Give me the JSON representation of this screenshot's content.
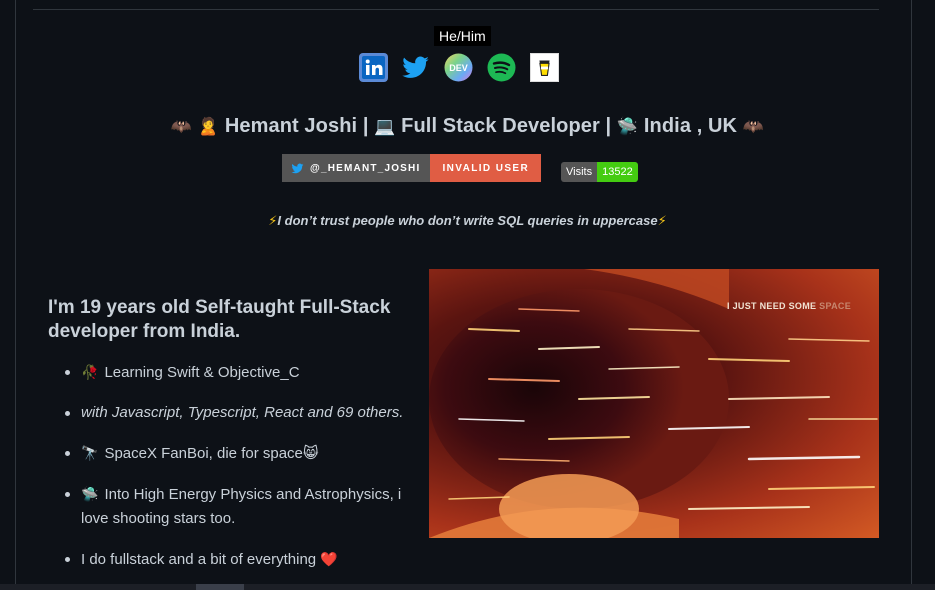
{
  "tooltip": "He/Him",
  "social": [
    {
      "name": "linkedin-icon",
      "label": "in",
      "color": "#0a66c2"
    },
    {
      "name": "twitter-icon",
      "color": "#1da1f2"
    },
    {
      "name": "dev-icon",
      "label": "DEV"
    },
    {
      "name": "spotify-icon",
      "color": "#1db954"
    },
    {
      "name": "buymeacoffee-icon",
      "color": "#ffdd00"
    }
  ],
  "headline": {
    "name": "Hemant Joshi |",
    "role": "Full Stack Developer |",
    "location": "India , UK"
  },
  "badges": {
    "twitter_handle": "@_HEMANT_JOSHI",
    "status": "INVALID USER",
    "visits_label": "Visits",
    "visits_count": "13522"
  },
  "quote": "I don’t trust people who don’t write SQL queries in uppercase",
  "intro": "I'm 19 years old Self-taught Full-Stack developer from India.",
  "list": [
    {
      "emoji": "🥀",
      "text": "Learning Swift & Objective_C"
    },
    {
      "text": "with Javascript, Typescript, React and 69 others."
    },
    {
      "emoji": "🔭",
      "text": "SpaceX FanBoi, die for space",
      "trail": "😸"
    },
    {
      "emoji": "🛸",
      "text": "Into High Energy Physics and Astrophysics, i love shooting stars too."
    },
    {
      "text": "I do fullstack and a bit of everything",
      "trail": "❤️"
    }
  ],
  "gif": {
    "caption_main": "I JUST NEED SOME",
    "caption_faint": "SPACE"
  },
  "colors": {
    "background": "#0d1117",
    "text": "#c9d1d9",
    "badge_status": "#e05d44",
    "visits_count_bg": "#44cc11"
  }
}
